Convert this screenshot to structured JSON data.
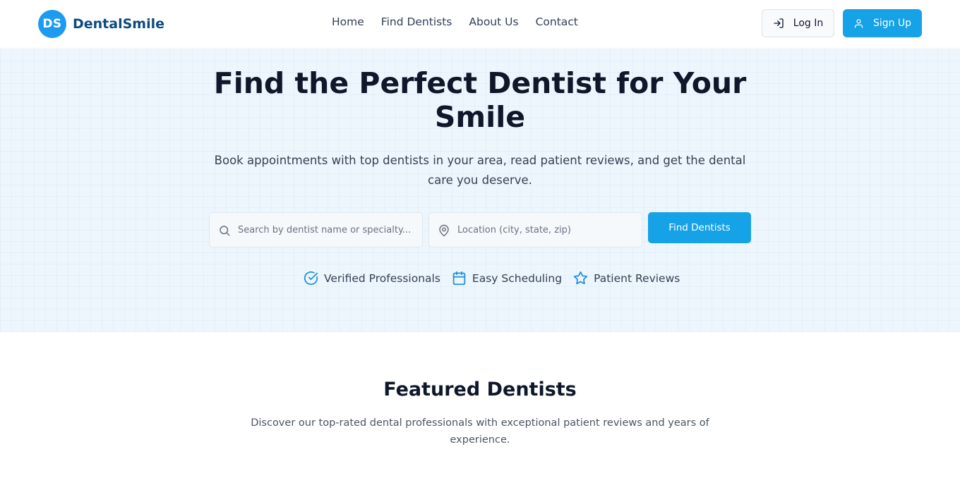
{
  "brand": {
    "badge": "DS",
    "name": "DentalSmile"
  },
  "nav": {
    "links": [
      "Home",
      "Find Dentists",
      "About Us",
      "Contact"
    ],
    "login_label": "Log In",
    "signup_label": "Sign Up"
  },
  "hero": {
    "title": "Find the Perfect Dentist for Your Smile",
    "subtitle": "Book appointments with top dentists in your area, read patient reviews, and get the dental care you deserve.",
    "search": {
      "name_placeholder": "Search by dentist name or specialty...",
      "name_value": "",
      "location_placeholder": "Location (city, state, zip)",
      "location_value": "",
      "button_label": "Find Dentists"
    },
    "features": [
      {
        "icon": "check-circle-icon",
        "label": "Verified Professionals"
      },
      {
        "icon": "calendar-icon",
        "label": "Easy Scheduling"
      },
      {
        "icon": "star-icon",
        "label": "Patient Reviews"
      }
    ]
  },
  "featured": {
    "title": "Featured Dentists",
    "subtitle": "Discover our top-rated dental professionals with exceptional patient reviews and years of experience."
  },
  "colors": {
    "accent": "#16a2e6",
    "brand_text": "#0c4a80",
    "hero_bg": "#eef6fd",
    "heading": "#0f172a"
  }
}
